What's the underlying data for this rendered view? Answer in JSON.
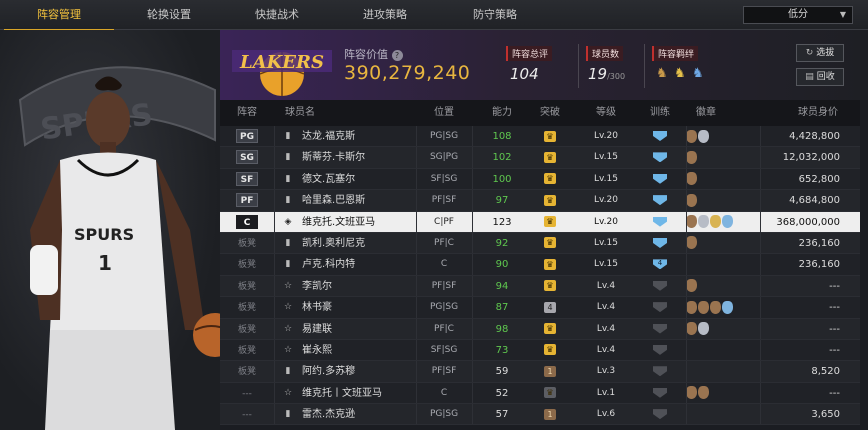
{
  "tabs": [
    {
      "label": "阵容管理",
      "active": true
    },
    {
      "label": "轮换设置",
      "active": false
    },
    {
      "label": "快捷战术",
      "active": false
    },
    {
      "label": "进攻策略",
      "active": false
    },
    {
      "label": "防守策略",
      "active": false
    }
  ],
  "sort": {
    "selected": "低分"
  },
  "team": {
    "logo_text": "LAKERS",
    "value_label": "阵容价值",
    "value": "390,279,240",
    "rating_label": "阵容总评",
    "rating": "104",
    "count_label": "球员数",
    "count": "19",
    "count_max": "/300",
    "bond_label": "阵容羁绊"
  },
  "buttons": {
    "select": "选拔",
    "recycle": "回收"
  },
  "columns": [
    "阵容",
    "球员名",
    "位置",
    "能力",
    "突破",
    "等级",
    "训练",
    "徽章",
    "球员身价"
  ],
  "colors": {
    "accent": "#e8b63f",
    "green": "#5fc84f",
    "team_purple": "#3a2457"
  },
  "players": [
    {
      "slot": "PG",
      "bench": false,
      "name": "达龙.福克斯",
      "pos": "PG|SG",
      "ability": "108",
      "ability_green": true,
      "break": "gold",
      "break_num": "",
      "level": "Lv.20",
      "train": "blue",
      "train_num": "",
      "badges": [
        "b-bronze",
        "b-silver"
      ],
      "value": "4,428,800"
    },
    {
      "slot": "SG",
      "bench": false,
      "name": "斯蒂芬.卡斯尔",
      "pos": "SG|PG",
      "ability": "102",
      "ability_green": true,
      "break": "gold",
      "break_num": "",
      "level": "Lv.15",
      "train": "blue",
      "train_num": "",
      "badges": [
        "b-bronze"
      ],
      "value": "12,032,000"
    },
    {
      "slot": "SF",
      "bench": false,
      "name": "德文.瓦塞尔",
      "pos": "SF|SG",
      "ability": "100",
      "ability_green": true,
      "break": "gold",
      "break_num": "",
      "level": "Lv.15",
      "train": "blue",
      "train_num": "",
      "badges": [
        "b-bronze"
      ],
      "value": "652,800"
    },
    {
      "slot": "PF",
      "bench": false,
      "name": "哈里森.巴恩斯",
      "pos": "PF|SF",
      "ability": "97",
      "ability_green": true,
      "break": "gold",
      "break_num": "",
      "level": "Lv.20",
      "train": "blue",
      "train_num": "",
      "badges": [
        "b-bronze"
      ],
      "value": "4,684,800"
    },
    {
      "slot": "C",
      "bench": false,
      "selected": true,
      "name": "维克托.文班亚马",
      "pos": "C|PF",
      "ability": "123",
      "ability_green": false,
      "break": "gold",
      "break_num": "",
      "level": "Lv.20",
      "train": "blue",
      "train_num": "",
      "badges": [
        "b-bronze",
        "b-silver",
        "b-gold",
        "b-blue"
      ],
      "value": "368,000,000"
    },
    {
      "slot": "板凳",
      "bench": true,
      "name": "凯利.奥利尼克",
      "pos": "PF|C",
      "ability": "92",
      "ability_green": true,
      "break": "gold",
      "break_num": "",
      "level": "Lv.15",
      "train": "blue",
      "train_num": "",
      "badges": [
        "b-bronze"
      ],
      "value": "236,160"
    },
    {
      "slot": "板凳",
      "bench": true,
      "name": "卢克.科内特",
      "pos": "C",
      "ability": "90",
      "ability_green": true,
      "break": "gold",
      "break_num": "",
      "level": "Lv.15",
      "train": "blue",
      "train_num": "4",
      "badges": [],
      "value": "236,160"
    },
    {
      "slot": "板凳",
      "bench": true,
      "name": "李凯尔",
      "pos": "PF|SF",
      "ability": "94",
      "ability_green": true,
      "break": "gold",
      "break_num": "",
      "level": "Lv.4",
      "train": "gray",
      "train_num": "",
      "badges": [
        "b-bronze"
      ],
      "value": "---"
    },
    {
      "slot": "板凳",
      "bench": true,
      "name": "林书豪",
      "pos": "PG|SG",
      "ability": "87",
      "ability_green": true,
      "break": "silver",
      "break_num": "4",
      "level": "Lv.4",
      "train": "gray",
      "train_num": "",
      "badges": [
        "b-bronze",
        "b-bronze",
        "b-bronze",
        "b-blue"
      ],
      "value": "---"
    },
    {
      "slot": "板凳",
      "bench": true,
      "name": "易建联",
      "pos": "PF|C",
      "ability": "98",
      "ability_green": true,
      "break": "gold",
      "break_num": "",
      "level": "Lv.4",
      "train": "gray",
      "train_num": "",
      "badges": [
        "b-bronze",
        "b-silver"
      ],
      "value": "---"
    },
    {
      "slot": "板凳",
      "bench": true,
      "name": "崔永熙",
      "pos": "SF|SG",
      "ability": "73",
      "ability_green": true,
      "break": "gold",
      "break_num": "",
      "level": "Lv.4",
      "train": "gray",
      "train_num": "",
      "badges": [],
      "value": "---"
    },
    {
      "slot": "板凳",
      "bench": true,
      "name": "阿约.多苏穆",
      "pos": "PF|SF",
      "ability": "59",
      "ability_green": false,
      "break": "bronze",
      "break_num": "1",
      "level": "Lv.3",
      "train": "gray",
      "train_num": "",
      "badges": [],
      "value": "8,520"
    },
    {
      "slot": "---",
      "bench": true,
      "name": "维克托丨文班亚马",
      "pos": "C",
      "ability": "52",
      "ability_green": false,
      "break": "gray",
      "break_num": "",
      "level": "Lv.1",
      "train": "gray",
      "train_num": "",
      "badges": [
        "b-bronze",
        "b-bronze"
      ],
      "value": "---"
    },
    {
      "slot": "---",
      "bench": true,
      "name": "雷杰.杰克逊",
      "pos": "PG|SG",
      "ability": "57",
      "ability_green": false,
      "break": "bronze",
      "break_num": "1",
      "level": "Lv.6",
      "train": "gray",
      "train_num": "",
      "badges": [],
      "value": "3,650"
    }
  ]
}
